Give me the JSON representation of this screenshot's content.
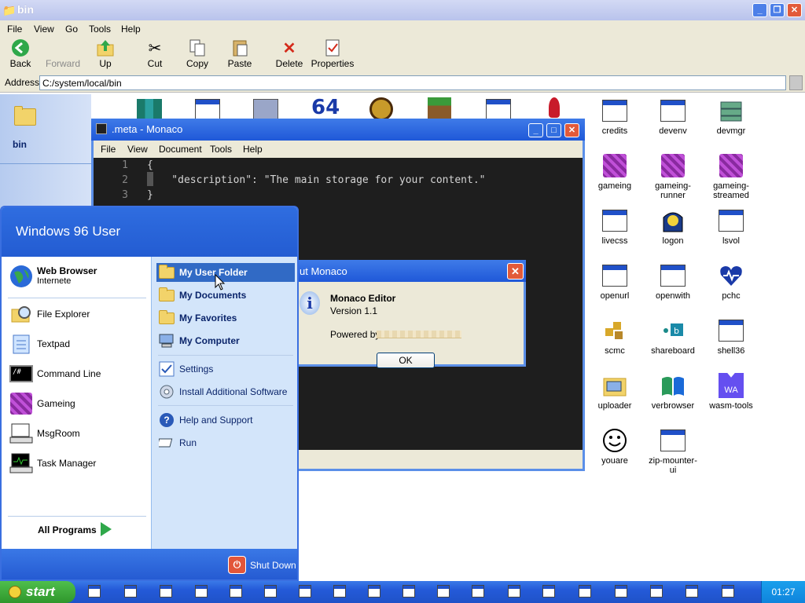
{
  "explorer": {
    "title": "bin",
    "menu": [
      "File",
      "View",
      "Go",
      "Tools",
      "Help"
    ],
    "toolbar": {
      "back": "Back",
      "forward": "Forward",
      "up": "Up",
      "cut": "Cut",
      "copy": "Copy",
      "paste": "Paste",
      "delete": "Delete",
      "properties": "Properties"
    },
    "address_label": "Address",
    "address_value": "C:/system/local/bin",
    "side_folder": "bin",
    "right_icons": [
      {
        "label": "credits",
        "icon": "window-icon"
      },
      {
        "label": "devenv",
        "icon": "window-icon"
      },
      {
        "label": "devmgr",
        "icon": "devmgr-icon"
      },
      {
        "label": "gameing",
        "icon": "cube-icon"
      },
      {
        "label": "gameing-runner",
        "icon": "cube-icon"
      },
      {
        "label": "gameing-streamed",
        "icon": "cube-icon"
      },
      {
        "label": "livecss",
        "icon": "window-icon"
      },
      {
        "label": "logon",
        "icon": "logon-icon"
      },
      {
        "label": "lsvol",
        "icon": "window-icon"
      },
      {
        "label": "openurl",
        "icon": "window-icon"
      },
      {
        "label": "openwith",
        "icon": "window-icon"
      },
      {
        "label": "pchc",
        "icon": "heart-icon"
      },
      {
        "label": "scmc",
        "icon": "scmc-icon"
      },
      {
        "label": "shareboard",
        "icon": "shareboard-icon"
      },
      {
        "label": "shell36",
        "icon": "window-icon"
      },
      {
        "label": "uploader",
        "icon": "uploader-icon"
      },
      {
        "label": "verbrowser",
        "icon": "flag-icon"
      },
      {
        "label": "wasm-tools",
        "icon": "wasm-icon"
      },
      {
        "label": "youare",
        "icon": "smiley-icon"
      },
      {
        "label": "zip-mounter-ui",
        "icon": "window-icon"
      }
    ]
  },
  "monaco": {
    "title": ".meta - Monaco",
    "menu": [
      "File",
      "View",
      "Document",
      "Tools",
      "Help"
    ],
    "lines": [
      {
        "num": "1",
        "text": "{"
      },
      {
        "num": "2",
        "text": "    \"description\": \"The main storage for your content.\""
      },
      {
        "num": "3",
        "text": "}"
      }
    ]
  },
  "about": {
    "title": "ut Monaco",
    "product": "Monaco Editor",
    "version": "Version 1.1",
    "powered_by": "Powered by",
    "ok": "OK"
  },
  "startmenu": {
    "user": "Windows 96 User",
    "pinned": {
      "name": "Web Browser",
      "sub": "Internete"
    },
    "left_items": [
      "File Explorer",
      "Textpad",
      "Command Line",
      "Gameing",
      "MsgRoom",
      "Task Manager"
    ],
    "all_programs": "All Programs",
    "right_items": [
      "My User Folder",
      "My Documents",
      "My Favorites",
      "My Computer"
    ],
    "right_items2": [
      "Settings",
      "Install Additional Software"
    ],
    "right_items3": [
      "Help and Support",
      "Run"
    ],
    "shutdown": "Shut Down"
  },
  "taskbar": {
    "start": "start",
    "clock": "01:27"
  }
}
